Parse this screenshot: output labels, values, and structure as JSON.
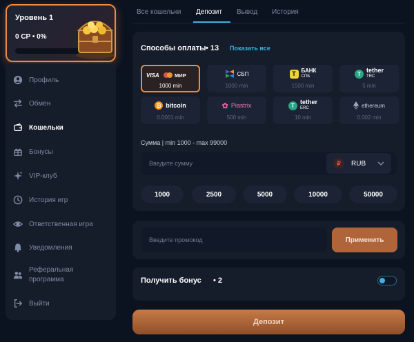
{
  "level": {
    "title": "Уровень 1",
    "cp": "0 CP • 0%",
    "progress": 0
  },
  "sidebar": {
    "items": [
      {
        "label": "Профиль",
        "icon": "user-icon"
      },
      {
        "label": "Обмен",
        "icon": "exchange-icon"
      },
      {
        "label": "Кошельки",
        "icon": "wallet-icon"
      },
      {
        "label": "Бонусы",
        "icon": "gift-icon"
      },
      {
        "label": "VIP-клуб",
        "icon": "sparkle-icon"
      },
      {
        "label": "История игр",
        "icon": "clock-icon"
      },
      {
        "label": "Ответственная игра",
        "icon": "eye-icon"
      },
      {
        "label": "Уведомления",
        "icon": "bell-icon"
      },
      {
        "label": "Реферальная программа",
        "icon": "people-icon"
      },
      {
        "label": "Выйти",
        "icon": "logout-icon"
      }
    ]
  },
  "tabs": [
    {
      "label": "Все кошельки"
    },
    {
      "label": "Депозит"
    },
    {
      "label": "Вывод"
    },
    {
      "label": "История"
    }
  ],
  "payment": {
    "title": "Способы оплаты",
    "count": "• 13",
    "show_all": "Показать все",
    "methods": [
      {
        "name": "VISA / MIR",
        "min": "1000 min"
      },
      {
        "name": "СБП",
        "min": "1000 min"
      },
      {
        "name": "БАНК СПБ",
        "min": "1500 min"
      },
      {
        "name": "tether TRC",
        "min": "5 min"
      },
      {
        "name": "bitcoin",
        "min": "0.0001 min"
      },
      {
        "name": "Piastrix",
        "min": "500 min"
      },
      {
        "name": "tether ERC",
        "min": "10 min"
      },
      {
        "name": "ethereum",
        "min": "0.002 min"
      }
    ],
    "sum_label": "Сумма | min 1000 - max 99000",
    "sum_placeholder": "Введите сумму",
    "currency": "RUB",
    "currency_symbol": "₽",
    "amounts": [
      "1000",
      "2500",
      "5000",
      "10000",
      "50000"
    ]
  },
  "promo": {
    "placeholder": "Введите промокод",
    "apply_label": "Применить"
  },
  "bonus": {
    "label": "Получить бонус",
    "count": "• 2"
  },
  "deposit_label": "Депозит",
  "colors": {
    "accent": "#f08a3c",
    "link": "#3fb0e0",
    "background": "#0b1220",
    "card": "#151c2a"
  }
}
